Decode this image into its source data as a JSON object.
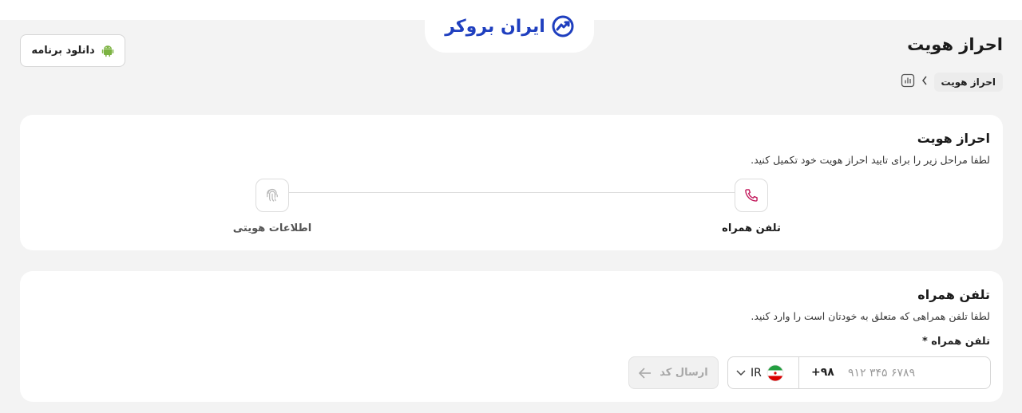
{
  "brand": {
    "logo_text": "ایران بروکر",
    "color": "#1f3fbf"
  },
  "header": {
    "download_label": "دانلود برنامه",
    "page_title": "احراز هویت"
  },
  "breadcrumb": {
    "current": "احراز هویت"
  },
  "identity_card": {
    "title": "احراز هویت",
    "description": "لطفا مراحل زیر را برای تایید احراز هویت خود تکمیل کنید.",
    "steps": [
      {
        "label": "تلفن همراه",
        "icon": "phone-icon",
        "active": true
      },
      {
        "label": "اطلاعات هویتی",
        "icon": "fingerprint-icon",
        "active": false
      }
    ]
  },
  "phone_card": {
    "title": "تلفن همراه",
    "description": "لطفا تلفن همراهی که متعلق به خودتان است را وارد کنید.",
    "field_label": "تلفن همراه *",
    "country_code": "IR",
    "dial_code": "+۹۸",
    "placeholder": "۹۱۲ ۳۴۵ ۶۷۸۹",
    "send_label": "ارسال کد"
  },
  "colors": {
    "accent": "#c2185b",
    "disabled_text": "#a8a8a8"
  }
}
